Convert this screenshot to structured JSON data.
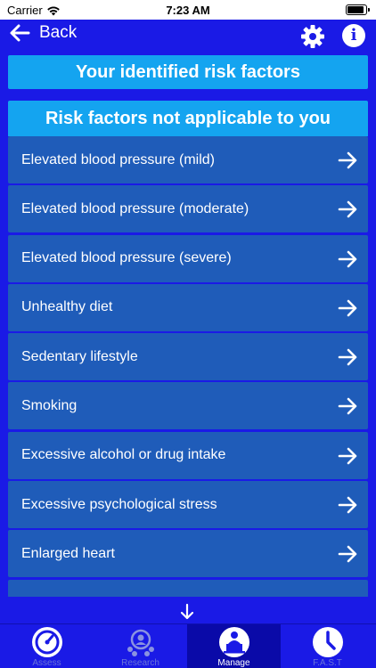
{
  "status": {
    "carrier": "Carrier",
    "time": "7:23 AM"
  },
  "nav": {
    "back_label": "Back"
  },
  "identified_title": "Your identified risk factors",
  "not_applicable_title": "Risk factors not applicable to you",
  "risk_items": [
    {
      "label": "Elevated blood pressure (mild)"
    },
    {
      "label": "Elevated blood pressure (moderate)"
    },
    {
      "label": "Elevated blood pressure (severe)"
    },
    {
      "label": "Unhealthy diet"
    },
    {
      "label": "Sedentary lifestyle"
    },
    {
      "label": "Smoking"
    },
    {
      "label": "Excessive alcohol or drug intake"
    },
    {
      "label": "Excessive psychological stress"
    },
    {
      "label": "Enlarged heart"
    }
  ],
  "tabs": [
    {
      "label": "Assess",
      "icon": "gauge-icon"
    },
    {
      "label": "Research",
      "icon": "research-people-icon"
    },
    {
      "label": "Manage",
      "icon": "manage-laptop-icon"
    },
    {
      "label": "F.A.S.T",
      "icon": "clock-icon"
    }
  ],
  "colors": {
    "background": "#1a1ae6",
    "banner": "#14a4f0",
    "row": "#1f5cb9",
    "active_tab": "#0a0aa8"
  }
}
